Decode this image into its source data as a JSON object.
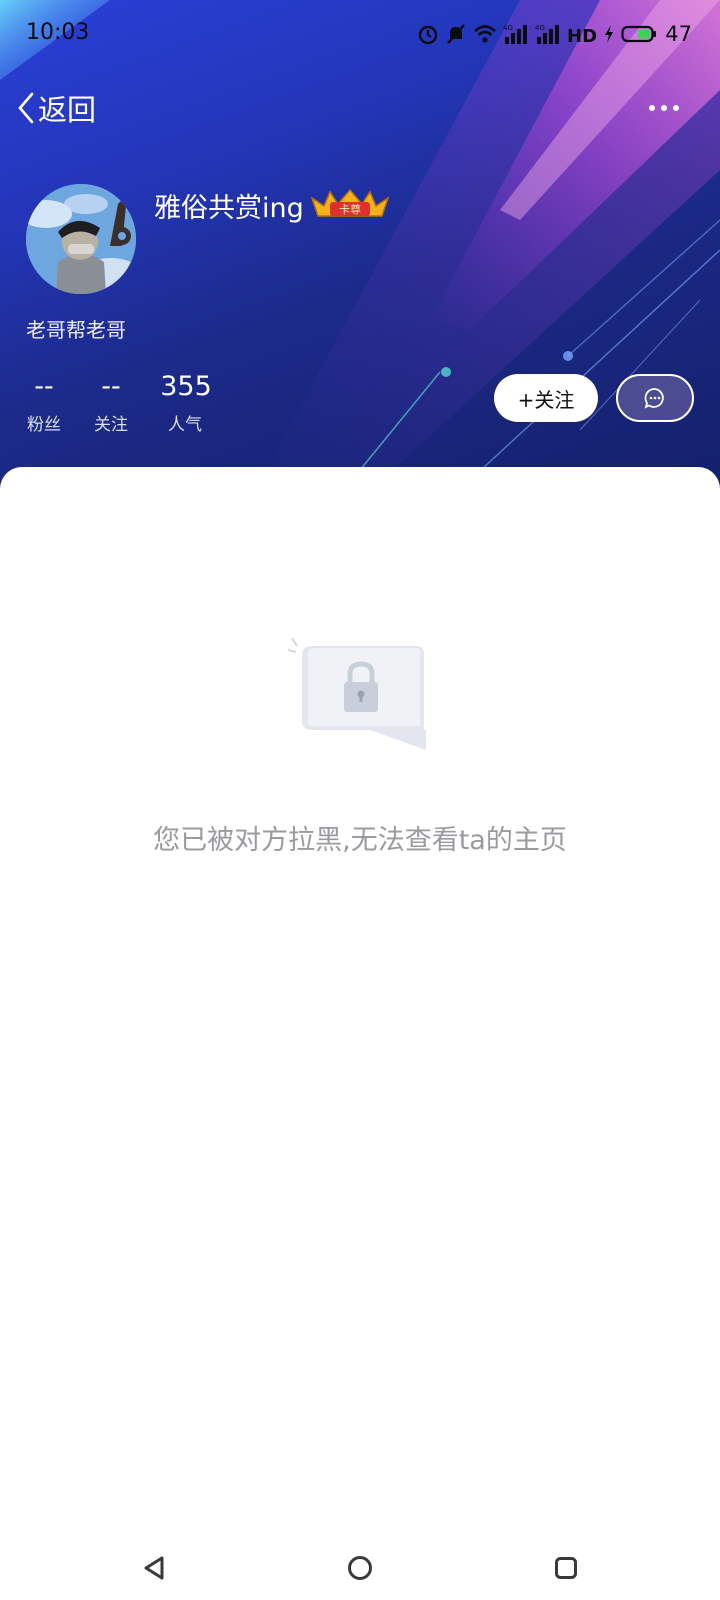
{
  "status_bar": {
    "time": "10:03",
    "battery_level": "47",
    "icons": [
      "alarm-icon",
      "mute-icon",
      "wifi-icon",
      "signal-4g-icon",
      "signal-4g-icon",
      "hd-icon",
      "charging-icon",
      "battery-icon"
    ]
  },
  "nav": {
    "back_label": "返回",
    "more_icon": "more-icon"
  },
  "profile": {
    "nickname": "雅俗共赏ing",
    "badge_text": "卡尊",
    "signature": "老哥帮老哥",
    "stats": [
      {
        "value": "--",
        "label": "粉丝"
      },
      {
        "value": "--",
        "label": "关注"
      },
      {
        "value": "355",
        "label": "人气"
      }
    ],
    "follow_label": "+关注",
    "message_icon": "chat-bubble-icon"
  },
  "content": {
    "blocked_message": "您已被对方拉黑,无法查看ta的主页",
    "illustration": "lock-icon"
  },
  "system_nav": [
    "back-triangle-icon",
    "home-circle-icon",
    "recents-square-icon"
  ],
  "colors": {
    "header_gradient_start": "#2a3fd8",
    "header_gradient_end": "#14206a",
    "accent_pink": "#d35ad8",
    "text_muted": "#9a9a9f"
  }
}
